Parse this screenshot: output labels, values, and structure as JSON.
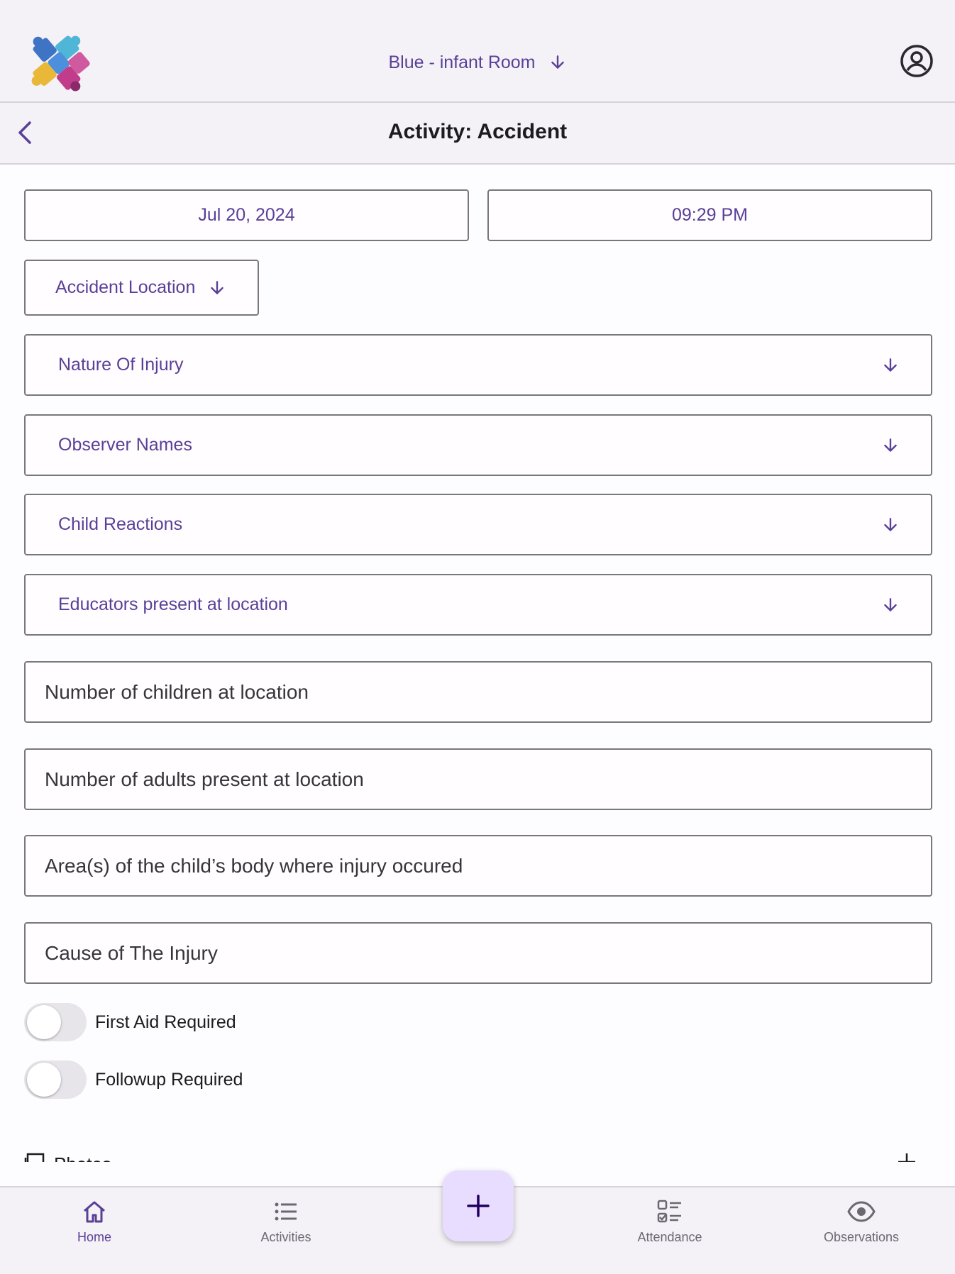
{
  "header": {
    "room_label": "Blue - infant Room",
    "icons": [
      "puzzle-logo",
      "arrow-down-icon",
      "account-circle-icon"
    ]
  },
  "titlebar": {
    "title": "Activity: Accident"
  },
  "form": {
    "date": "Jul 20, 2024",
    "time": "09:29 PM",
    "accident_location": "Accident Location",
    "dropdowns": [
      "Nature Of Injury",
      "Observer Names",
      "Child Reactions",
      "Educators present at location"
    ],
    "inputs": [
      "Number of children at location",
      "Number of adults present at location",
      "Area(s) of the child’s body where injury occured",
      "Cause of The Injury"
    ],
    "toggles": [
      {
        "label": "First Aid Required",
        "on": false
      },
      {
        "label": "Followup Required",
        "on": false
      }
    ],
    "photos_label": "Photos"
  },
  "nav": {
    "items": [
      "Home",
      "Activities",
      "Attendance",
      "Observations"
    ],
    "active": "Home"
  },
  "colors": {
    "accent": "#5a3f97",
    "bar_bg": "#f4f2f7",
    "fab_bg": "#e9ddff"
  }
}
